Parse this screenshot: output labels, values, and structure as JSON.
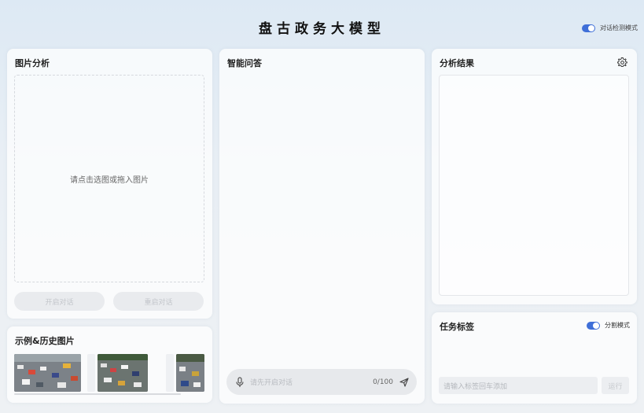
{
  "app": {
    "title": "盘古政务大模型"
  },
  "top_toggle": {
    "label": "对话检测模式",
    "on": true
  },
  "image_panel": {
    "title": "图片分析",
    "dropzone_text": "请点击选图或拖入图片",
    "start_button": "开启对话",
    "restart_button": "重启对话"
  },
  "history_panel": {
    "title": "示例&历史图片"
  },
  "chat_panel": {
    "title": "智能问答",
    "input_placeholder": "请先开启对话",
    "counter": "0/100"
  },
  "result_panel": {
    "title": "分析结果"
  },
  "tags_panel": {
    "title": "任务标签",
    "toggle_label": "分割模式",
    "toggle_on": true,
    "input_placeholder": "请输入标签回车添加",
    "run_button": "运行"
  },
  "colors": {
    "accent": "#3f6fd8"
  }
}
